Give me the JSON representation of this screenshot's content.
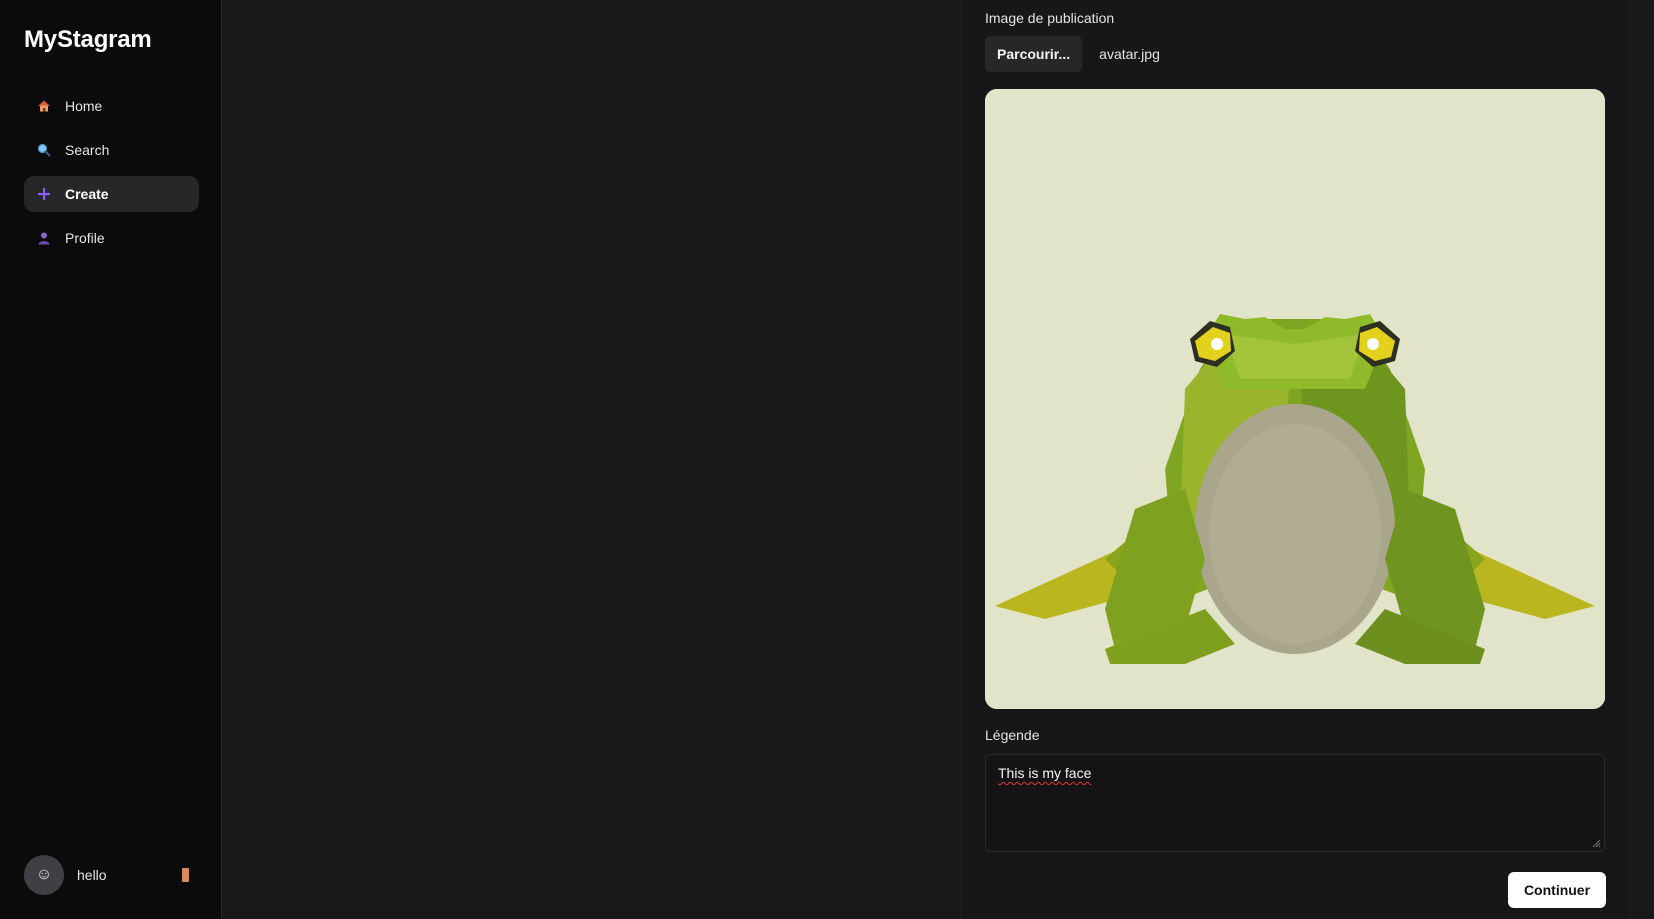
{
  "app": {
    "brand": "MyStagram"
  },
  "sidebar": {
    "items": [
      {
        "label": "Home",
        "icon": "house-icon"
      },
      {
        "label": "Search",
        "icon": "magnifier-icon"
      },
      {
        "label": "Create",
        "icon": "plus-icon",
        "active": true
      },
      {
        "label": "Profile",
        "icon": "person-icon"
      }
    ],
    "user": {
      "name": "hello",
      "avatar_glyph": "☺",
      "logout_icon": "logout-icon"
    }
  },
  "form": {
    "image_label": "Image de publication",
    "browse_label": "Parcourir...",
    "file_name": "avatar.jpg",
    "preview_subject": "low-poly green frog",
    "caption_label": "Légende",
    "caption_value": "This is my face",
    "continue_label": "Continuer"
  },
  "colors": {
    "accent_plus": "#8b5cf6",
    "preview_background": "#e2e4c9",
    "logout_icon": "#d98b5f"
  }
}
